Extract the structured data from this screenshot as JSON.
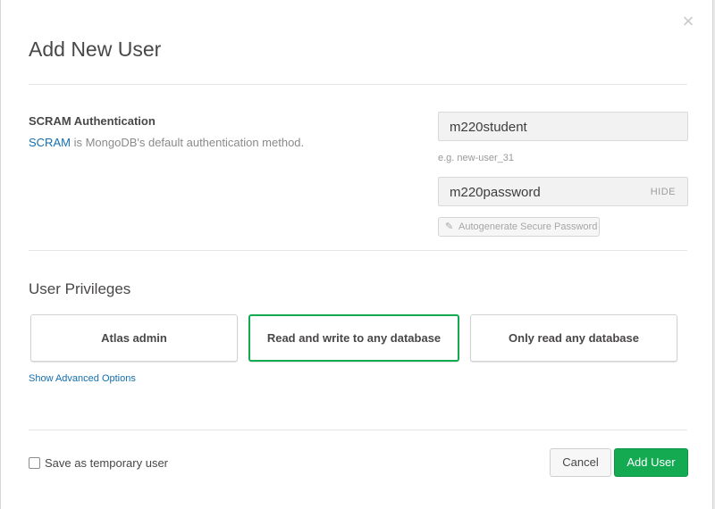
{
  "dialog": {
    "title": "Add New User",
    "close_glyph": "×",
    "close_icon": "close-icon"
  },
  "auth": {
    "heading": "SCRAM Authentication",
    "link_text": "SCRAM",
    "description_rest": " is MongoDB's default authentication method.",
    "username_value": "m220student",
    "username_hint": "e.g. new-user_31",
    "password_value": "m220password",
    "password_toggle": "HIDE",
    "autogen_label": "Autogenerate Secure Password",
    "autogen_icon": "wrench-icon",
    "autogen_glyph": "✎"
  },
  "privileges": {
    "heading": "User Privileges",
    "options": [
      {
        "label": "Atlas admin",
        "selected": false
      },
      {
        "label": "Read and write to any database",
        "selected": true
      },
      {
        "label": "Only read any database",
        "selected": false
      }
    ],
    "advanced_link": "Show Advanced Options"
  },
  "footer": {
    "temporary_label": "Save as temporary user",
    "temporary_checked": false,
    "cancel_label": "Cancel",
    "add_label": "Add User"
  },
  "colors": {
    "accent_green": "#13aa52",
    "link_blue": "#136fb1",
    "text_dark": "#494747",
    "text_muted": "#8a8a8a"
  }
}
